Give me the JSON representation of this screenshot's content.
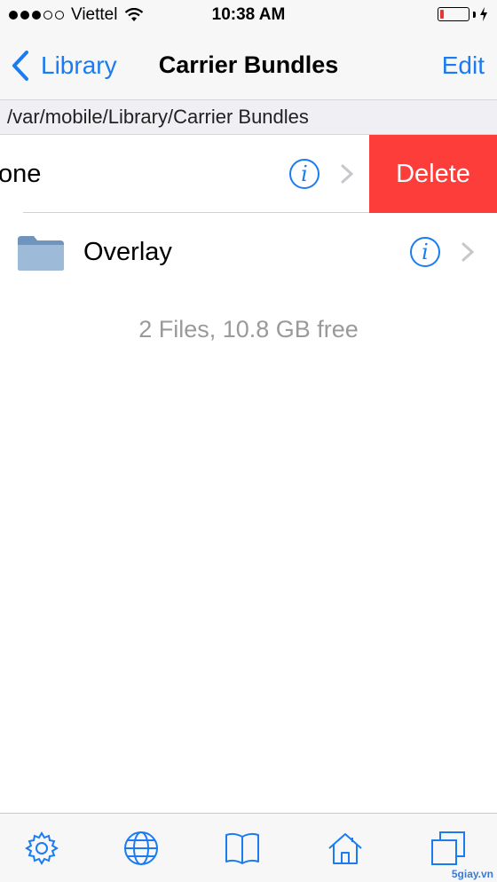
{
  "status_bar": {
    "carrier": "Viettel",
    "time": "10:38 AM"
  },
  "nav": {
    "back_label": "Library",
    "title": "Carrier Bundles",
    "edit_label": "Edit"
  },
  "path": "/var/mobile/Library/Carrier Bundles",
  "rows": [
    {
      "label": "one",
      "delete_label": "Delete"
    },
    {
      "label": "Overlay"
    }
  ],
  "footer": "2 Files, 10.8 GB free",
  "tabs": [
    "gear-icon",
    "globe-icon",
    "book-icon",
    "home-icon",
    "windows-icon"
  ],
  "watermark": "5giay.vn",
  "colors": {
    "accent": "#1a7cf0",
    "delete": "#fc3d39",
    "battery_level": "#e53935"
  }
}
